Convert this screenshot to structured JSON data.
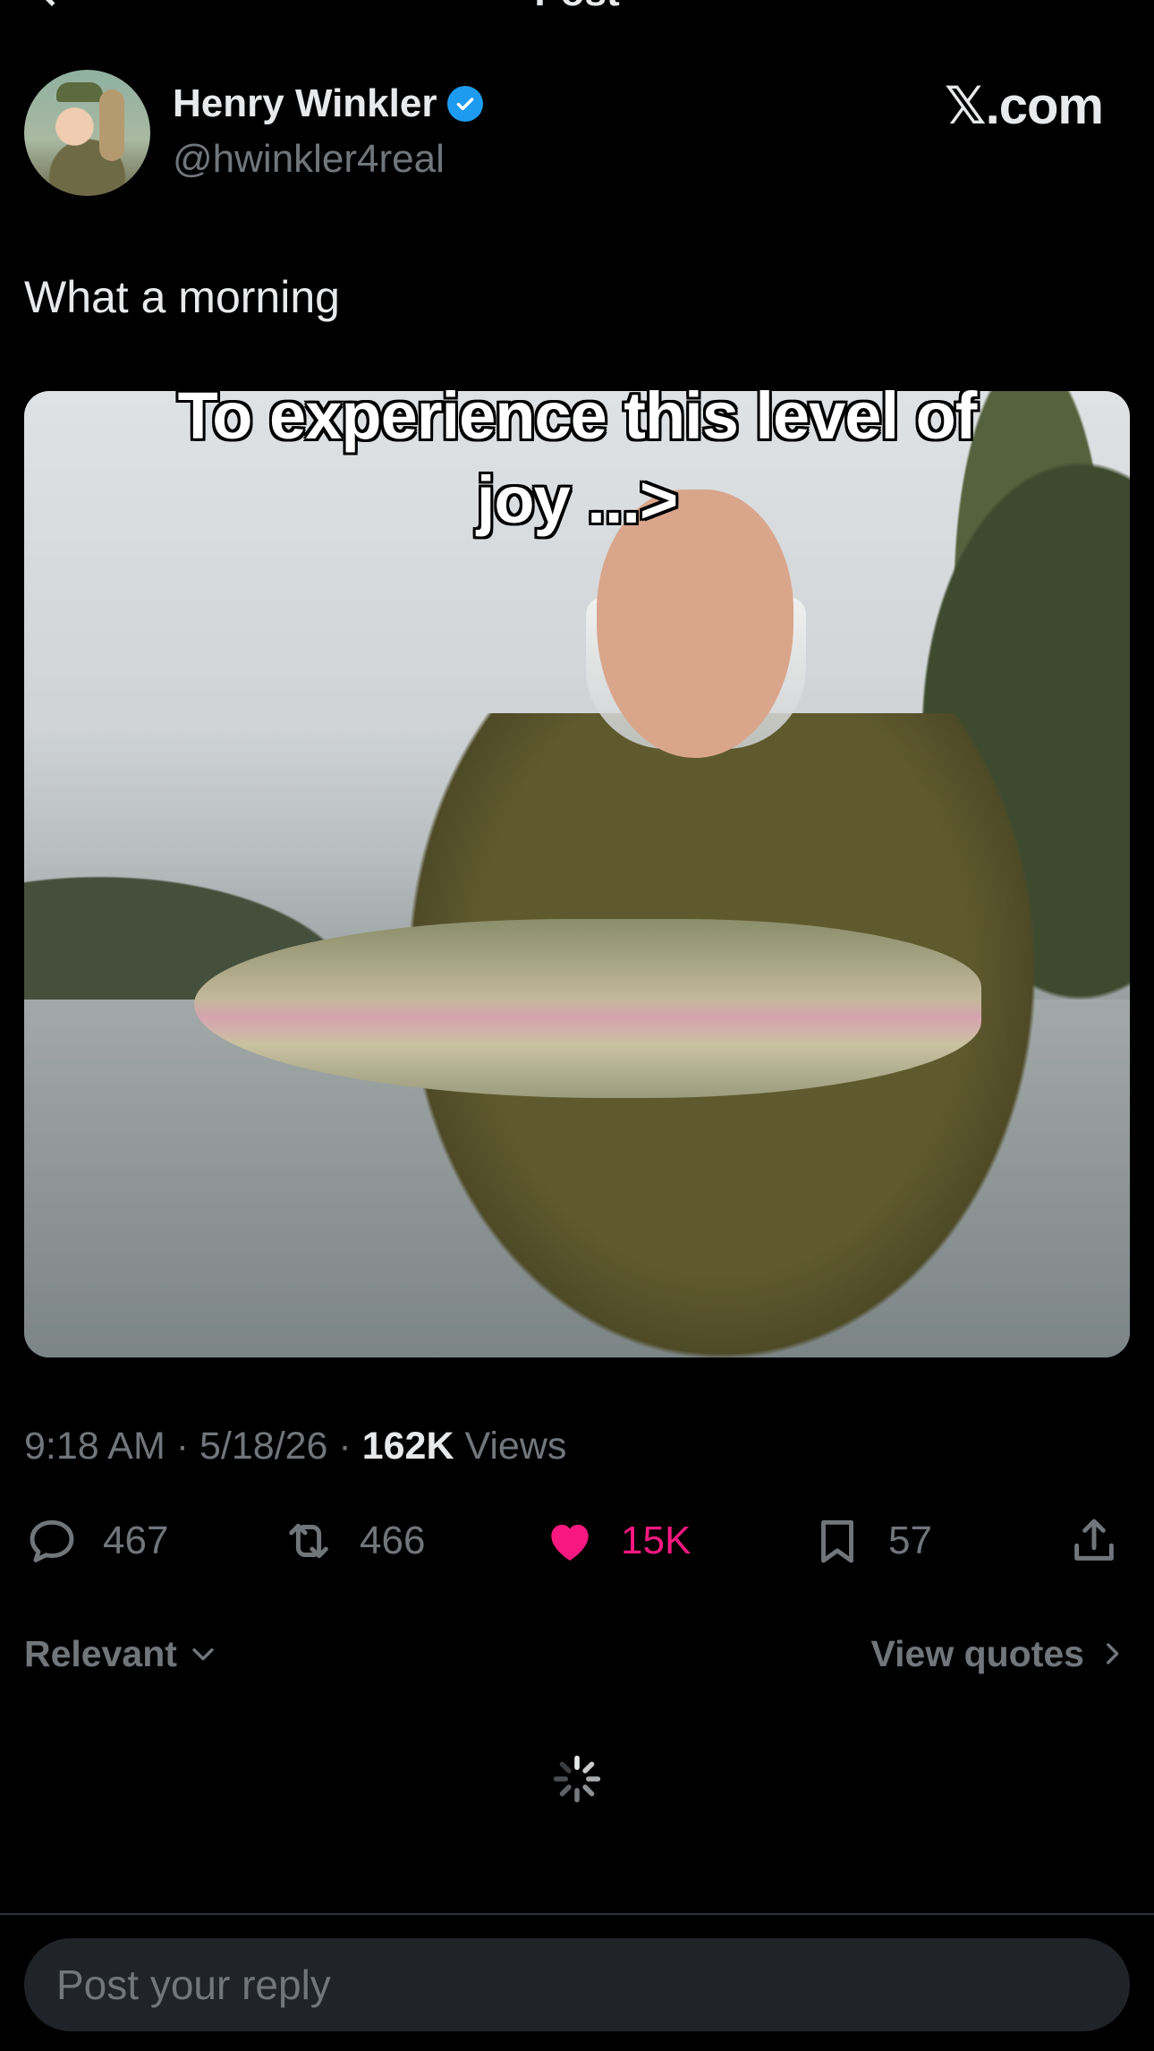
{
  "header": {
    "title": "Post",
    "back_icon": "chevron-left-icon"
  },
  "author": {
    "name": "Henry Winkler",
    "handle": "@hwinkler4real",
    "verified": true,
    "verified_color": "#1d9bf0"
  },
  "watermark": "𝕏.com",
  "post": {
    "text": "What a morning",
    "image_caption": "To experience this level of\njoy ...>",
    "time": "9:18 AM",
    "date": "5/18/26",
    "views_count": "162K",
    "views_label": "Views"
  },
  "actions": {
    "reply_count": "467",
    "repost_count": "466",
    "like_count": "15K",
    "bookmark_count": "57",
    "liked": true,
    "like_color": "#f91880"
  },
  "replies": {
    "sort_label": "Relevant",
    "view_quotes_label": "View quotes"
  },
  "composer": {
    "placeholder": "Post your reply"
  },
  "colors": {
    "background": "#000000",
    "text_primary": "#e7e9ea",
    "text_secondary": "#71767b",
    "input_bg": "#202327"
  }
}
